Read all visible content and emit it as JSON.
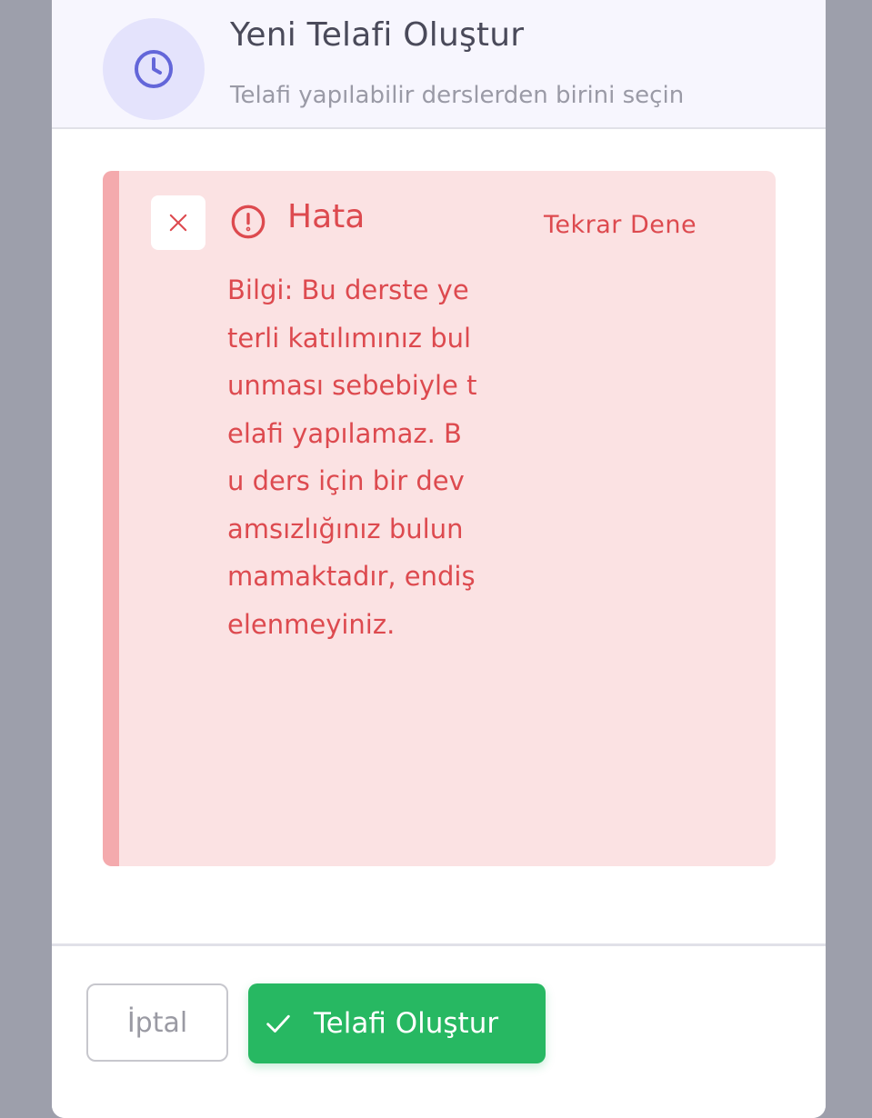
{
  "header": {
    "icon": "clock-icon",
    "title": "Yeni Telafi Oluştur",
    "subtitle": "Telafi yapılabilir derslerden birini seçin"
  },
  "alert": {
    "close_icon": "close-icon",
    "warning_icon": "alert-circle-icon",
    "title": "Hata",
    "retry_label": "Tekrar Dene",
    "message": "Bilgi: Bu derste yeterli katılımınız bulunması sebebiyle telafi yapılamaz. Bu ders için bir devamsızlığınız bulunmamaktadır, endişelenmeyiniz."
  },
  "footer": {
    "cancel_label": "İptal",
    "submit_label": "Telafi Oluştur",
    "submit_icon": "check-icon"
  },
  "colors": {
    "accent": "#6366d9",
    "error": "#dd4a4f",
    "error_bg": "#fbe2e3",
    "success": "#27b862"
  }
}
